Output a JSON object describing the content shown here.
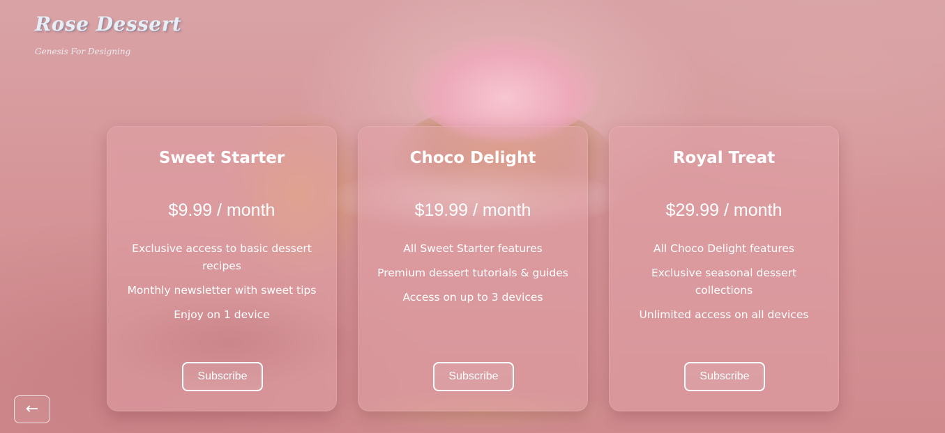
{
  "brand": {
    "title": "Rose Dessert",
    "subtitle": "Genesis For Designing"
  },
  "plans": [
    {
      "name": "Sweet Starter",
      "price": "$9.99 / month",
      "features": [
        "Exclusive access to basic dessert recipes",
        "Monthly newsletter with sweet tips",
        "Enjoy on 1 device"
      ],
      "button_label": "Subscribe"
    },
    {
      "name": "Choco Delight",
      "price": "$19.99 / month",
      "features": [
        "All Sweet Starter features",
        "Premium dessert tutorials & guides",
        "Access on up to 3 devices"
      ],
      "button_label": "Subscribe"
    },
    {
      "name": "Royal Treat",
      "price": "$29.99 / month",
      "features": [
        "All Choco Delight features",
        "Exclusive seasonal dessert collections",
        "Unlimited access on all devices"
      ],
      "button_label": "Subscribe"
    }
  ],
  "navigation": {
    "back_label": "←"
  }
}
